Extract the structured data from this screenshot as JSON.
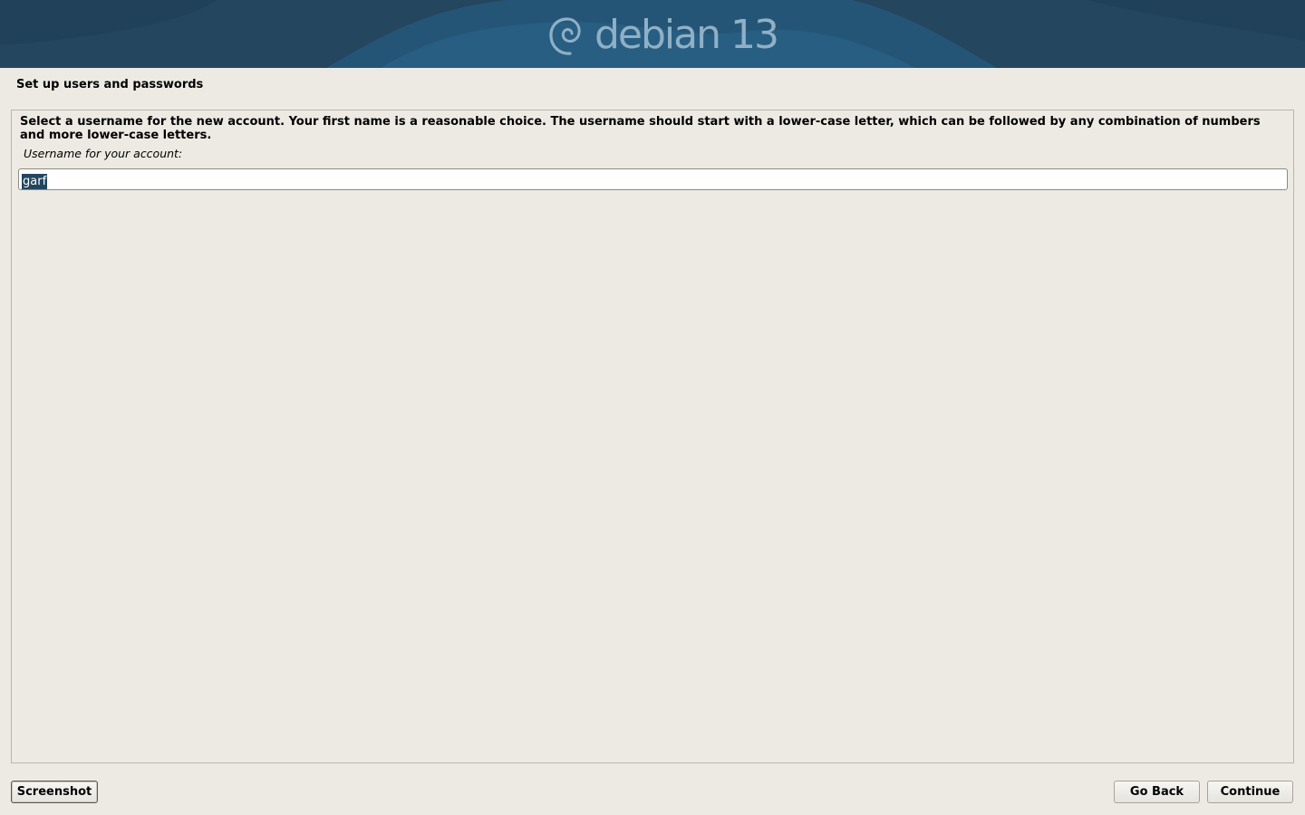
{
  "banner": {
    "logo_text": "debian 13",
    "colors": {
      "background": "#24465f",
      "logo": "#8fb0c6"
    },
    "icon": "debian-swirl-icon"
  },
  "step_title": "Set up users and passwords",
  "main": {
    "description": "Select a username for the new account. Your first name is a reasonable choice. The username should start with a lower-case letter, which can be followed by any combination of numbers and more lower-case letters.",
    "field_label": "Username for your account:",
    "username_value": "garf"
  },
  "buttons": {
    "screenshot": "Screenshot",
    "go_back": "Go Back",
    "continue": "Continue"
  }
}
